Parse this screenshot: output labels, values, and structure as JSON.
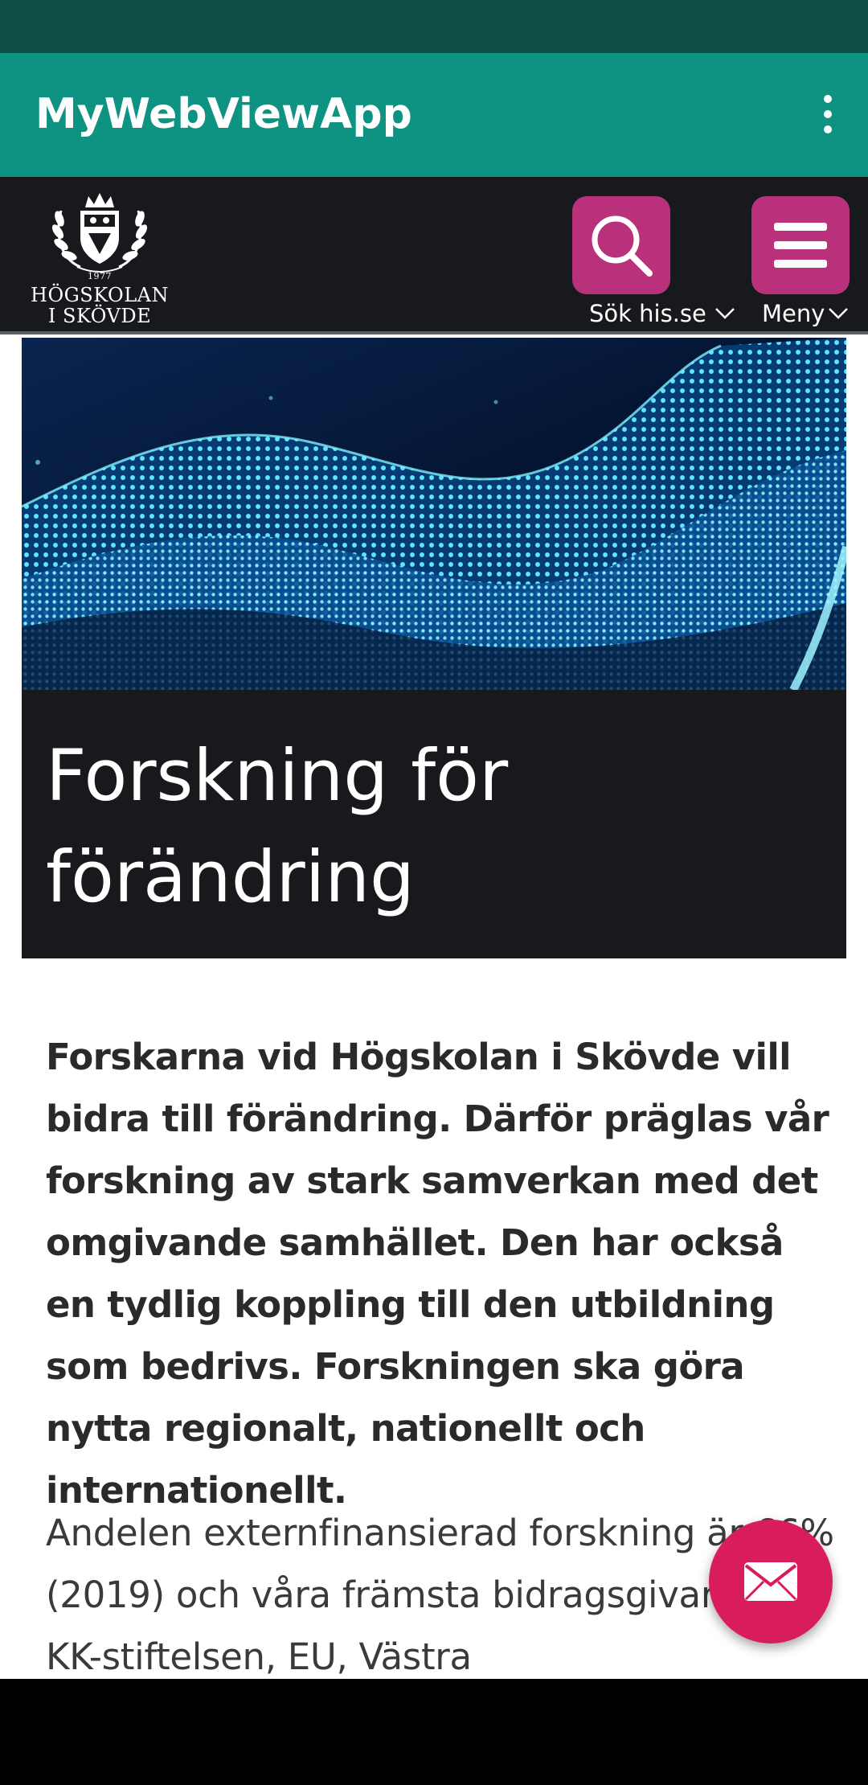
{
  "app_bar": {
    "title": "MyWebViewApp",
    "overflow_icon": "more-vert-icon"
  },
  "site_header": {
    "logo_year": "1977",
    "logo_line1": "HÖGSKOLAN",
    "logo_line2": "I SKÖVDE",
    "search_label": "Sök his.se",
    "menu_label": "Meny",
    "colors": {
      "header_bg": "#17191c",
      "button_bg": "#b8317a"
    }
  },
  "hero": {
    "title": "Forskning för förändring"
  },
  "content": {
    "lead": "Forskarna vid Högskolan i Skövde vill bidra till förändring. Därför präglas vår forskning av stark samverkan med det omgivande samhället. Den har också en tydlig koppling till den utbildning som bedrivs. Forskningen ska göra nytta regionalt, nationellt och internationellt.",
    "body": "Andelen externfinansierad forskning är 66% (2019) och våra främsta bidragsgivare är KK-stiftelsen, EU, Västra"
  },
  "fab": {
    "icon": "envelope-icon",
    "color": "#d91c5c"
  },
  "theme": {
    "status_bar": "#0c4e45",
    "app_bar": "#0e9282"
  }
}
